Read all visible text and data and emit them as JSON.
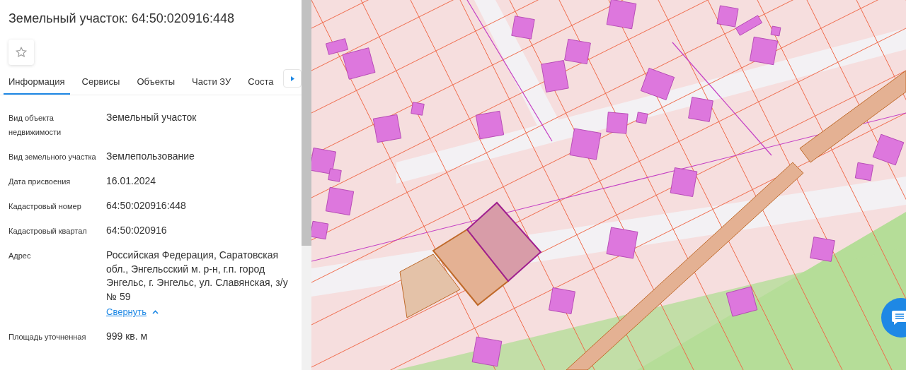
{
  "title": "Земельный участок: 64:50:020916:448",
  "tabs": [
    {
      "label": "Информация",
      "selected": true
    },
    {
      "label": "Сервисы",
      "selected": false
    },
    {
      "label": "Объекты",
      "selected": false
    },
    {
      "label": "Части ЗУ",
      "selected": false
    },
    {
      "label": "Соста",
      "selected": false
    }
  ],
  "fields": [
    {
      "label": "Вид объекта недвижимости",
      "value": "Земельный участок"
    },
    {
      "label": "Вид земельного участка",
      "value": "Землепользование"
    },
    {
      "label": "Дата присвоения",
      "value": "16.01.2024"
    },
    {
      "label": "Кадастровый номер",
      "value": "64:50:020916:448"
    },
    {
      "label": "Кадастровый квартал",
      "value": "64:50:020916"
    },
    {
      "label": "Адрес",
      "value": "Российская Федерация, Саратовская обл., Энгельсский м. р-н, г.п. город Энгельс, г. Энгельс, ул. Славянская, з/у № 59",
      "link": "Свернуть"
    },
    {
      "label": "Площадь уточненная",
      "value": "999 кв. м"
    }
  ]
}
